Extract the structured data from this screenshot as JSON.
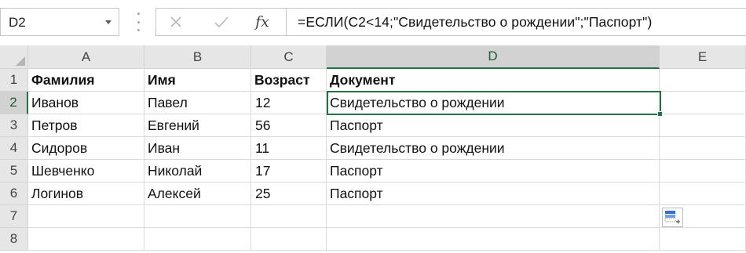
{
  "name_box": {
    "value": "D2"
  },
  "formula_bar": {
    "fx_label": "fx",
    "formula": "=ЕСЛИ(C2<14;\"Свидетельство о рождении\";\"Паспорт\")"
  },
  "sheet": {
    "columns": [
      "A",
      "B",
      "C",
      "D",
      "E"
    ],
    "rows": [
      "1",
      "2",
      "3",
      "4",
      "5",
      "6",
      "7",
      "8"
    ],
    "selected_cell": "D2",
    "header_row": [
      "Фамилия",
      "Имя",
      "Возраст",
      "Документ"
    ],
    "data_rows": [
      [
        "Иванов",
        "Павел",
        "12",
        "Свидетельство о рождении"
      ],
      [
        "Петров",
        "Евгений",
        "56",
        "Паспорт"
      ],
      [
        "Сидоров",
        "Иван",
        "11",
        "Свидетельство о рождении"
      ],
      [
        "Шевченко",
        "Николай",
        "17",
        "Паспорт"
      ],
      [
        "Логинов",
        "Алексей",
        "25",
        "Паспорт"
      ]
    ]
  },
  "colors": {
    "selection": "#217346",
    "header_bg": "#e6e6e6",
    "header_selected_bg": "#d2d2d2",
    "gridline": "#dadada"
  },
  "icons": {
    "cancel": "close-icon",
    "enter": "checkmark-icon",
    "insert_function": "fx-icon",
    "quick_analysis": "quick-analysis-icon",
    "select_all": "select-all-triangle-icon"
  }
}
